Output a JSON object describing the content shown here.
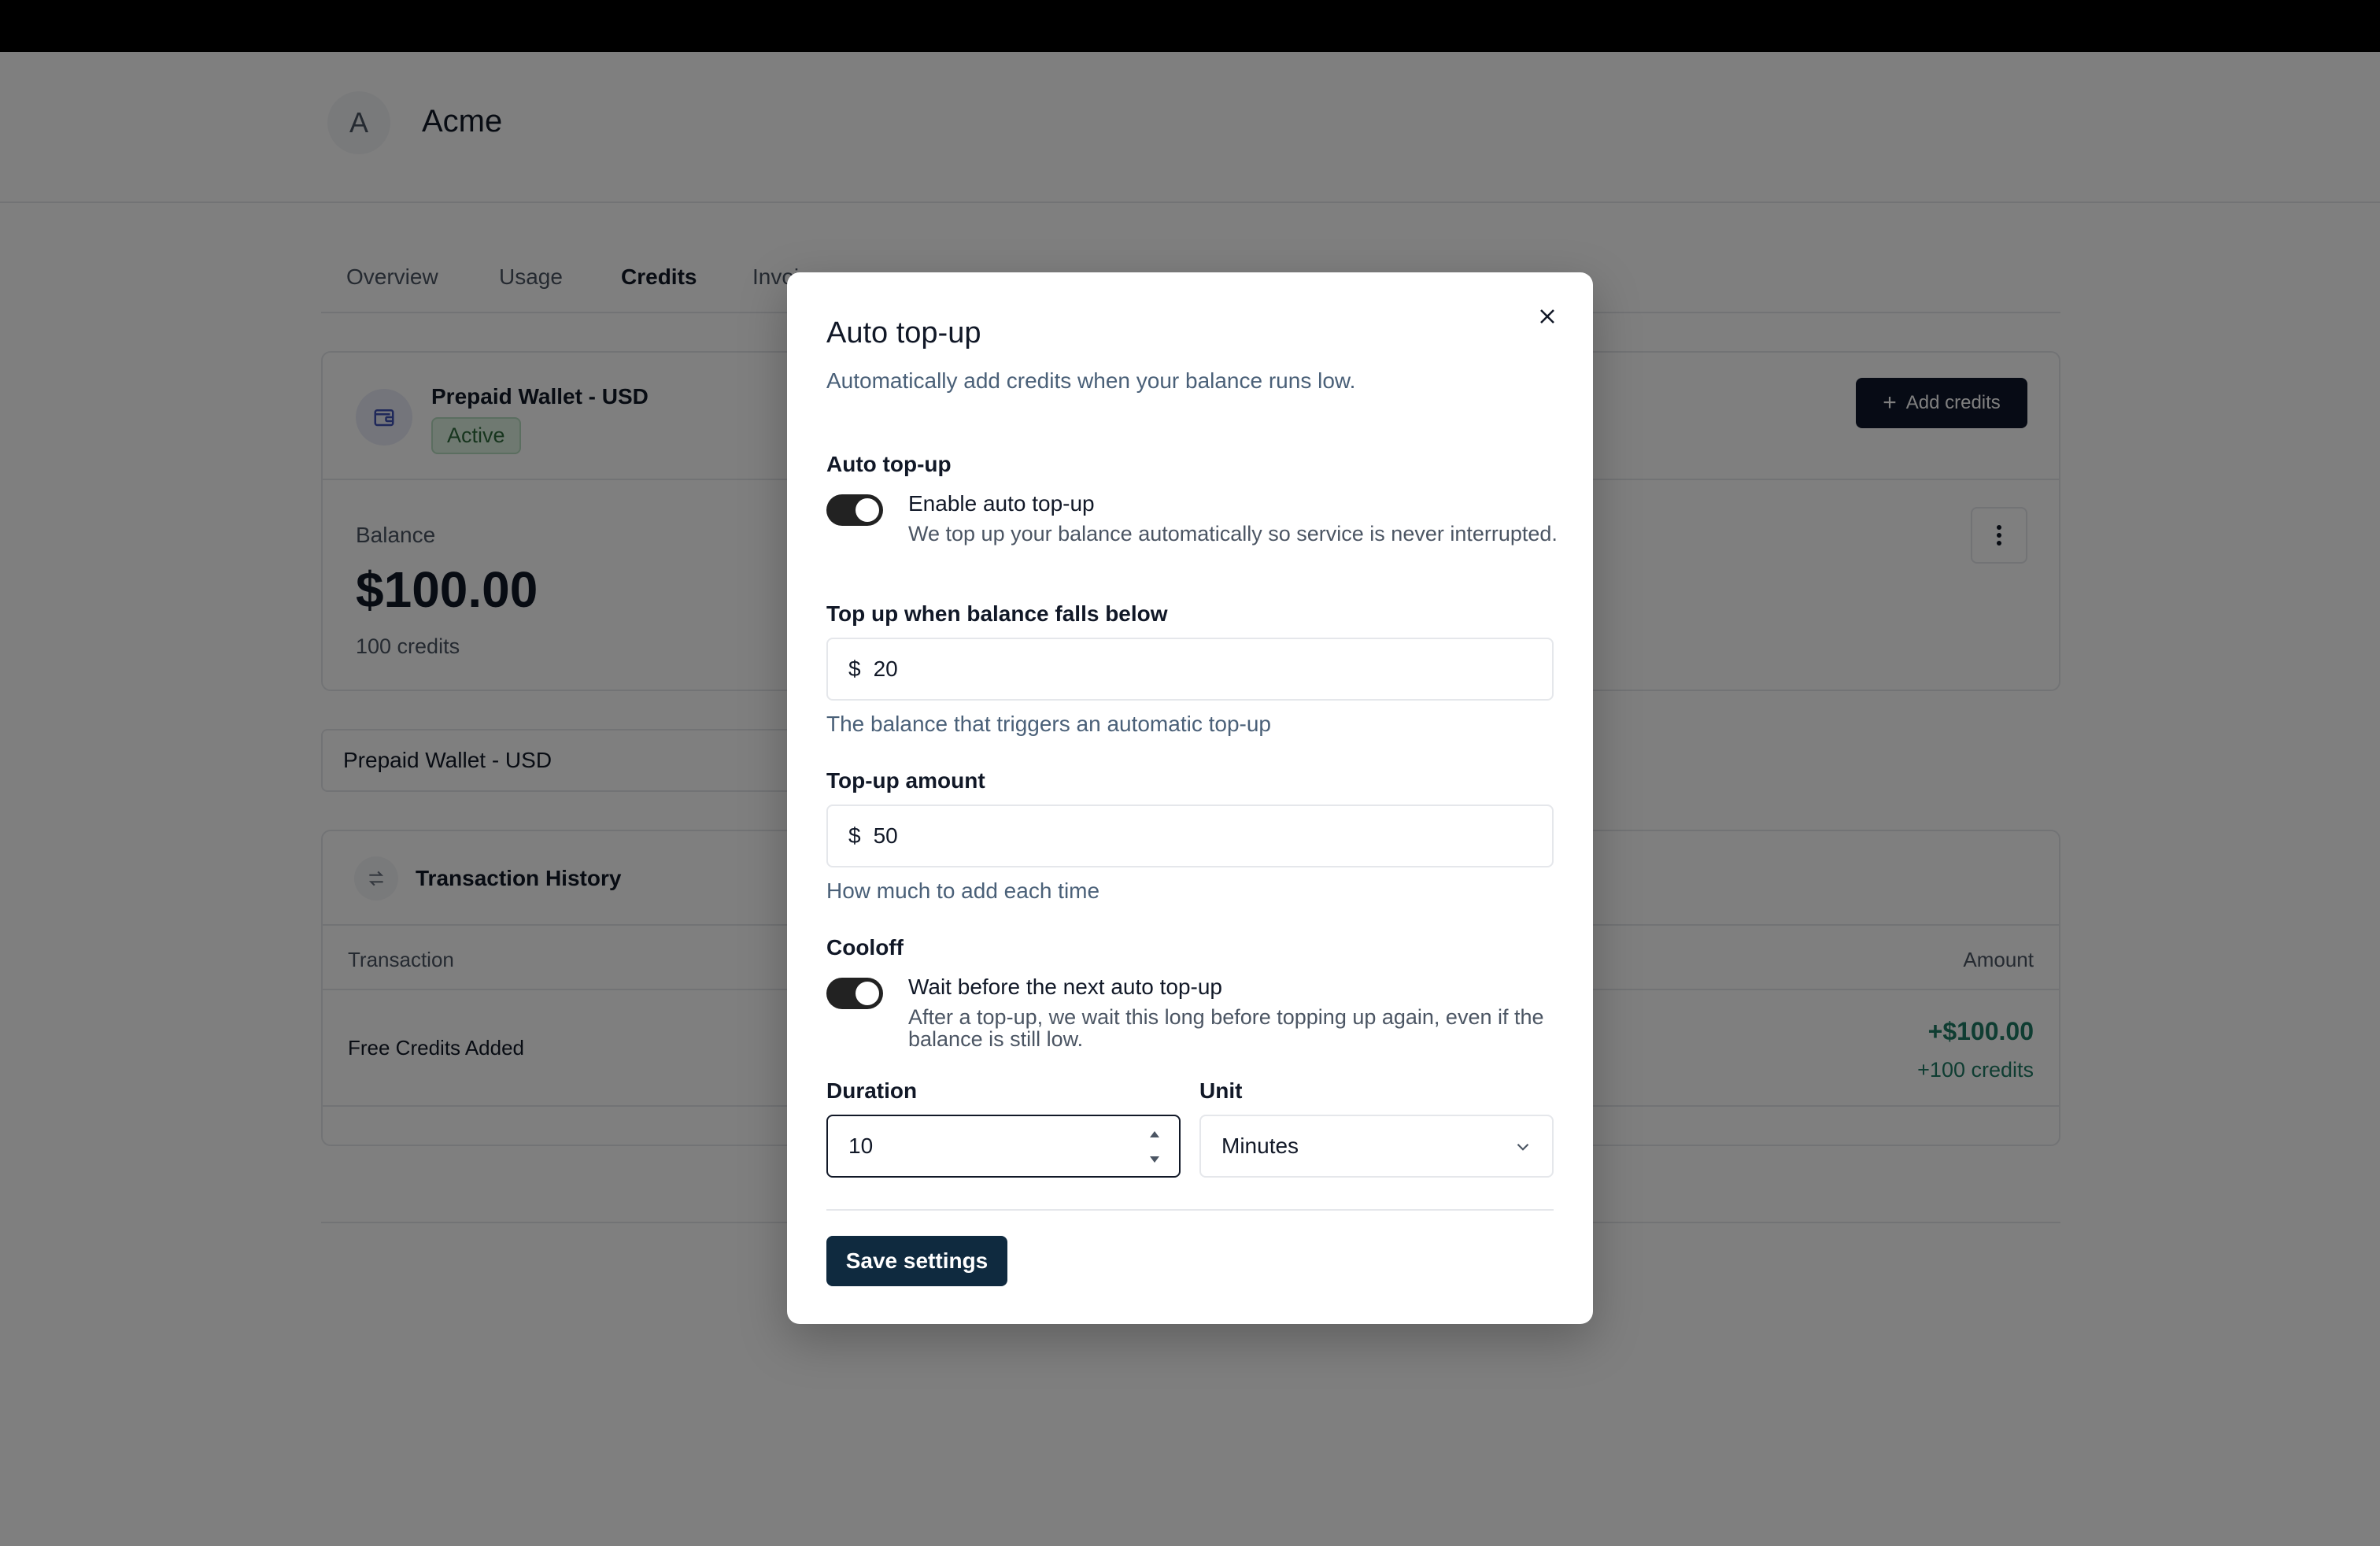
{
  "org": {
    "avatar_letter": "A",
    "name": "Acme"
  },
  "tabs": [
    {
      "label": "Overview"
    },
    {
      "label": "Usage"
    },
    {
      "label": "Credits"
    },
    {
      "label": "Invoices"
    }
  ],
  "wallet": {
    "name": "Prepaid Wallet - USD",
    "status": "Active",
    "add_credits_label": "Add credits",
    "balance_label": "Balance",
    "balance_value": "$100.00",
    "balance_credits": "100 credits"
  },
  "wallet_select": {
    "value": "Prepaid Wallet - USD"
  },
  "transactions": {
    "title": "Transaction History",
    "columns": {
      "transaction": "Transaction",
      "amount": "Amount"
    },
    "rows": [
      {
        "name": "Free Credits Added",
        "amount": "+$100.00",
        "credits": "+100 credits"
      }
    ]
  },
  "modal": {
    "title": "Auto top-up",
    "description": "Automatically add credits when your balance runs low.",
    "section_auto": "Auto top-up",
    "enable_title": "Enable auto top-up",
    "enable_desc": "We top up your balance automatically so service is never interrupted.",
    "threshold_label": "Top up when balance falls below",
    "threshold_prefix": "$",
    "threshold_value": "20",
    "threshold_hint": "The balance that triggers an automatic top-up",
    "amount_label": "Top-up amount",
    "amount_prefix": "$",
    "amount_value": "50",
    "amount_hint": "How much to add each time",
    "section_cooloff": "Cooloff",
    "cooloff_title": "Wait before the next auto top-up",
    "cooloff_desc": "After a top-up, we wait this long before topping up again, even if the balance is still low.",
    "duration_label": "Duration",
    "duration_value": "10",
    "unit_label": "Unit",
    "unit_value": "Minutes",
    "save_label": "Save settings"
  }
}
